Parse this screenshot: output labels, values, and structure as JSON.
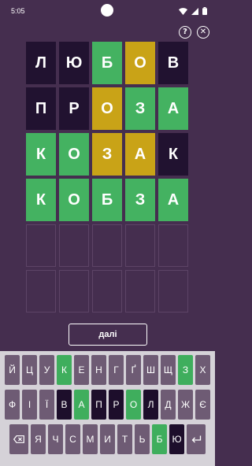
{
  "status_bar": {
    "time": "5:05"
  },
  "header": {
    "help_glyph": "?",
    "close_glyph": "✕"
  },
  "board": [
    [
      {
        "letter": "л",
        "state": "absent"
      },
      {
        "letter": "ю",
        "state": "absent"
      },
      {
        "letter": "б",
        "state": "correct"
      },
      {
        "letter": "о",
        "state": "present"
      },
      {
        "letter": "в",
        "state": "absent"
      }
    ],
    [
      {
        "letter": "п",
        "state": "absent"
      },
      {
        "letter": "р",
        "state": "absent"
      },
      {
        "letter": "о",
        "state": "present"
      },
      {
        "letter": "з",
        "state": "correct"
      },
      {
        "letter": "а",
        "state": "correct"
      }
    ],
    [
      {
        "letter": "к",
        "state": "correct"
      },
      {
        "letter": "о",
        "state": "correct"
      },
      {
        "letter": "з",
        "state": "present"
      },
      {
        "letter": "а",
        "state": "present"
      },
      {
        "letter": "к",
        "state": "absent"
      }
    ],
    [
      {
        "letter": "к",
        "state": "correct"
      },
      {
        "letter": "о",
        "state": "correct"
      },
      {
        "letter": "б",
        "state": "correct"
      },
      {
        "letter": "з",
        "state": "correct"
      },
      {
        "letter": "а",
        "state": "correct"
      }
    ],
    [
      {
        "letter": "",
        "state": "empty"
      },
      {
        "letter": "",
        "state": "empty"
      },
      {
        "letter": "",
        "state": "empty"
      },
      {
        "letter": "",
        "state": "empty"
      },
      {
        "letter": "",
        "state": "empty"
      }
    ],
    [
      {
        "letter": "",
        "state": "empty"
      },
      {
        "letter": "",
        "state": "empty"
      },
      {
        "letter": "",
        "state": "empty"
      },
      {
        "letter": "",
        "state": "empty"
      },
      {
        "letter": "",
        "state": "empty"
      }
    ]
  ],
  "next_button": {
    "label": "далі"
  },
  "keyboard": {
    "rows": [
      [
        {
          "key": "й",
          "state": "default"
        },
        {
          "key": "ц",
          "state": "default"
        },
        {
          "key": "у",
          "state": "default"
        },
        {
          "key": "к",
          "state": "correct"
        },
        {
          "key": "е",
          "state": "default"
        },
        {
          "key": "н",
          "state": "default"
        },
        {
          "key": "г",
          "state": "default"
        },
        {
          "key": "ґ",
          "state": "default"
        },
        {
          "key": "ш",
          "state": "default"
        },
        {
          "key": "щ",
          "state": "default"
        },
        {
          "key": "з",
          "state": "correct"
        },
        {
          "key": "х",
          "state": "default"
        }
      ],
      [
        {
          "key": "ф",
          "state": "default"
        },
        {
          "key": "і",
          "state": "default"
        },
        {
          "key": "ї",
          "state": "default"
        },
        {
          "key": "в",
          "state": "absent"
        },
        {
          "key": "а",
          "state": "correct"
        },
        {
          "key": "п",
          "state": "absent"
        },
        {
          "key": "р",
          "state": "absent"
        },
        {
          "key": "о",
          "state": "correct"
        },
        {
          "key": "л",
          "state": "absent"
        },
        {
          "key": "д",
          "state": "default"
        },
        {
          "key": "ж",
          "state": "default"
        },
        {
          "key": "є",
          "state": "default"
        }
      ],
      [
        {
          "key": "backspace",
          "state": "default",
          "icon": "backspace-icon"
        },
        {
          "key": "я",
          "state": "default"
        },
        {
          "key": "ч",
          "state": "default"
        },
        {
          "key": "с",
          "state": "default"
        },
        {
          "key": "м",
          "state": "default"
        },
        {
          "key": "и",
          "state": "default"
        },
        {
          "key": "т",
          "state": "default"
        },
        {
          "key": "ь",
          "state": "default"
        },
        {
          "key": "б",
          "state": "correct"
        },
        {
          "key": "ю",
          "state": "absent"
        },
        {
          "key": "enter",
          "state": "default",
          "icon": "enter-icon"
        }
      ]
    ]
  },
  "colors": {
    "background": "#452e4f",
    "tile_absent": "#211230",
    "tile_correct": "#44b261",
    "tile_present": "#c9a317",
    "key_default": "#6e5b74",
    "keyboard_bg": "#d5d2d8"
  }
}
